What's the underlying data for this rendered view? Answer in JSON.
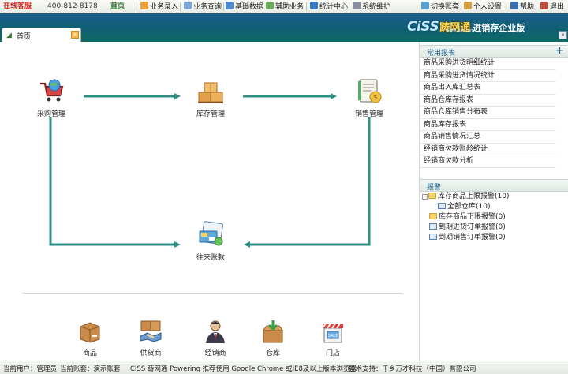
{
  "topbar": {
    "online_service": "在线客服",
    "phone": "400-812-8178",
    "home": "首页",
    "menu": [
      {
        "label": "业务录入",
        "icon": "edit-icon",
        "color": "#e9a23b"
      },
      {
        "label": "业务查询",
        "icon": "search-doc-icon",
        "color": "#7aa6d6"
      },
      {
        "label": "基础数据",
        "icon": "data-icon",
        "color": "#4f8ad0"
      },
      {
        "label": "辅助业务",
        "icon": "tools-icon",
        "color": "#6aa85a"
      },
      {
        "label": "统计中心",
        "icon": "chart-icon",
        "color": "#3a7ac0"
      },
      {
        "label": "系统维护",
        "icon": "settings-icon",
        "color": "#8a8fa0"
      }
    ],
    "right_menu": [
      {
        "label": "切换账套",
        "icon": "switch-icon",
        "color": "#5aa0d0"
      },
      {
        "label": "个人设置",
        "icon": "user-settings-icon",
        "color": "#d0a040"
      },
      {
        "label": "帮助",
        "icon": "help-icon",
        "color": "#3a70b0"
      },
      {
        "label": "退出",
        "icon": "exit-icon",
        "color": "#c04a3a"
      }
    ]
  },
  "header": {
    "tab_label": "首页",
    "brand_name": "CiSS",
    "brand_cn": "踌网通",
    "brand_url": "www.ciss.com",
    "brand_tagline": "进销存企业版"
  },
  "flow": {
    "purchase": "采购管理",
    "inventory": "库存管理",
    "sales": "销售管理",
    "accounts": "往来账款"
  },
  "shortcuts": [
    "商品",
    "供货商",
    "经销商",
    "仓库",
    "门店"
  ],
  "reports": {
    "title": "常用报表",
    "items": [
      "商品采购进货明细统计",
      "商品采购进货情况统计",
      "商品出入库汇总表",
      "商品仓库存报表",
      "商品仓库销售分布表",
      "商品库存报表",
      "商品销售情况汇总",
      "经销商欠款账龄统计",
      "经销商欠款分析"
    ]
  },
  "alerts": {
    "title": "报警",
    "tree": [
      {
        "label": "库存商品上限报警(10)",
        "type": "folder",
        "level": 0,
        "expanded": true
      },
      {
        "label": "全部仓库(10)",
        "type": "doc",
        "level": 1
      },
      {
        "label": "库存商品下限报警(0)",
        "type": "folder",
        "level": 0
      },
      {
        "label": "到期进货订单报警(0)",
        "type": "doc",
        "level": 0
      },
      {
        "label": "到期销售订单报警(0)",
        "type": "doc",
        "level": 0
      }
    ]
  },
  "status": {
    "user": "当前用户：管理员",
    "account": "当前账套：演示账套",
    "notice": "CISS 踌网通 Powering 推荐使用 Google Chrome 或IE8及以上版本浏览器",
    "support": "技术支持：千乡万才科技（中国）有限公司"
  }
}
